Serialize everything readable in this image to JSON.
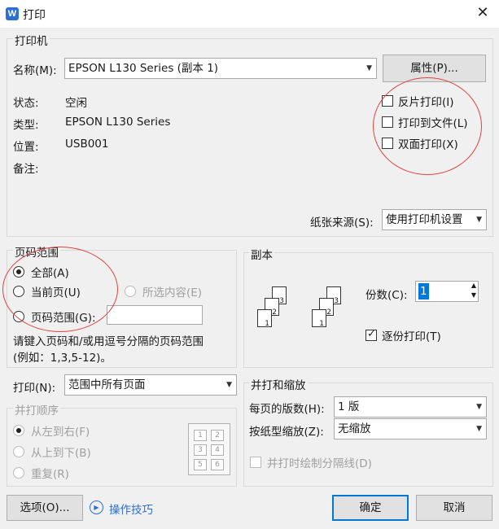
{
  "window": {
    "title": "打印",
    "app_icon_letter": "W"
  },
  "printer": {
    "group_label": "打印机",
    "name_label": "名称(M):",
    "name_value": "EPSON L130 Series (副本 1)",
    "properties_button": "属性(P)...",
    "status_label": "状态:",
    "status_value": "空闲",
    "type_label": "类型:",
    "type_value": "EPSON L130 Series",
    "location_label": "位置:",
    "location_value": "USB001",
    "comment_label": "备注:",
    "options": [
      {
        "label": "反片打印(I)",
        "checked": false
      },
      {
        "label": "打印到文件(L)",
        "checked": false
      },
      {
        "label": "双面打印(X)",
        "checked": false
      }
    ],
    "paper_source_label": "纸张来源(S):",
    "paper_source_value": "使用打印机设置"
  },
  "page_range": {
    "group_label": "页码范围",
    "all_label": "全部(A)",
    "current_label": "当前页(U)",
    "selection_label": "所选内容(E)",
    "range_label": "页码范围(G):",
    "range_value": "",
    "hint_line1": "请键入页码和/或用逗号分隔的页码范围",
    "hint_line2": "(例如：1,3,5-12)。",
    "selected": "all"
  },
  "print_what": {
    "label": "打印(N):",
    "value": "范围中所有页面"
  },
  "print_order": {
    "group_label": "并打顺序",
    "options": [
      "从左到右(F)",
      "从上到下(B)",
      "重复(R)"
    ],
    "grid_numbers": [
      "1",
      "2",
      "3",
      "4",
      "5",
      "6"
    ]
  },
  "copies": {
    "group_label": "副本",
    "count_label": "份数(C):",
    "count_value": "1",
    "collate_label": "逐份打印(T)",
    "collate_checked": true,
    "page_numbers": [
      "1",
      "2",
      "3"
    ]
  },
  "zoom": {
    "group_label": "并打和缩放",
    "pages_per_sheet_label": "每页的版数(H):",
    "pages_per_sheet_value": "1 版",
    "scale_label": "按纸型缩放(Z):",
    "scale_value": "无缩放",
    "draw_borders_label": "并打时绘制分隔线(D)"
  },
  "footer": {
    "options_button": "选项(O)...",
    "tips_link": "操作技巧",
    "ok_button": "确定",
    "cancel_button": "取消"
  },
  "colors": {
    "annotation_circle": "#e0433d",
    "accent": "#0078d7",
    "link": "#2b6fd6"
  }
}
